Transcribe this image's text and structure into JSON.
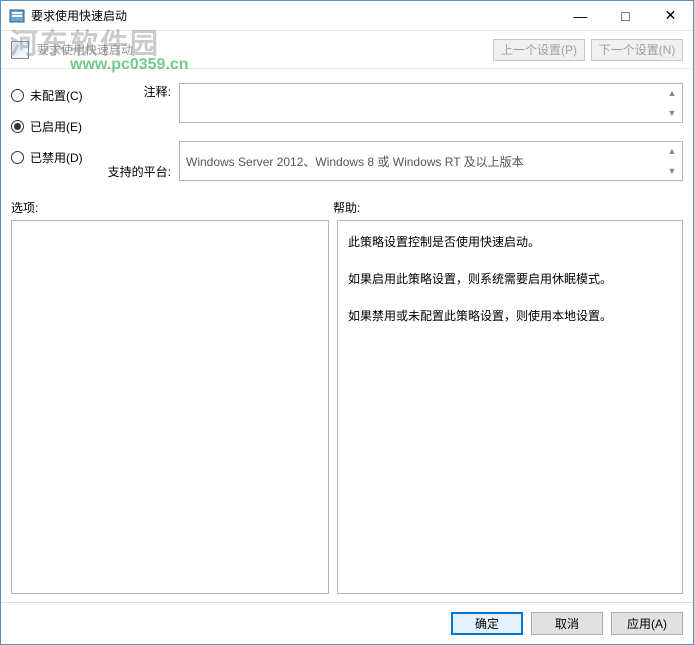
{
  "window": {
    "title": "要求使用快速启动"
  },
  "watermark": {
    "cn": "河东软件园",
    "url": "www.pc0359.cn"
  },
  "subheader": {
    "subtitle": "要求使用快速启动",
    "prev": "上一个设置(P)",
    "next": "下一个设置(N)"
  },
  "radios": {
    "notconfig": "未配置(C)",
    "enabled": "已启用(E)",
    "disabled": "已禁用(D)"
  },
  "labels": {
    "comment": "注释:",
    "platform": "支持的平台:",
    "options": "选项:",
    "help": "帮助:"
  },
  "fields": {
    "comment": "",
    "platform": "Windows Server 2012、Windows 8 或 Windows RT 及以上版本"
  },
  "help": {
    "p1": "此策略设置控制是否使用快速启动。",
    "p2": "如果启用此策略设置，则系统需要启用休眠模式。",
    "p3": "如果禁用或未配置此策略设置，则使用本地设置。"
  },
  "buttons": {
    "ok": "确定",
    "cancel": "取消",
    "apply": "应用(A)"
  }
}
